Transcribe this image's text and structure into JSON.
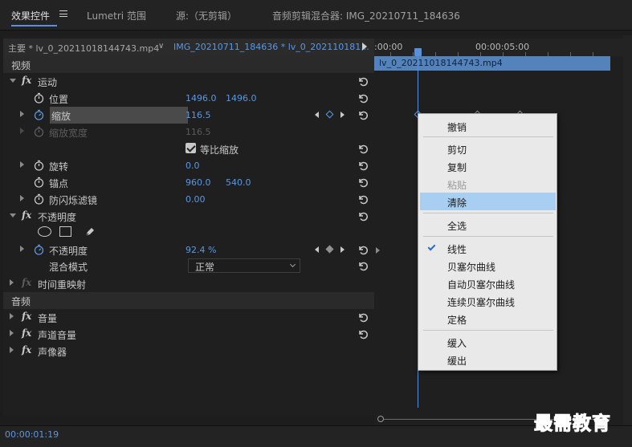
{
  "panel_tabs": {
    "effect_controls": "效果控件",
    "lumetri": "Lumetri 范围",
    "source": "源:（无剪辑）",
    "audio_mixer": "音频剪辑混合器: IMG_20210711_184636"
  },
  "source_bar": {
    "master": "主要 * lv_0_20211018144743.mp4",
    "clip": "IMG_20210711_184636 * lv_0_202110181..."
  },
  "sections": {
    "video": "视频",
    "audio": "音频"
  },
  "effects": {
    "motion": {
      "name": "运动",
      "position": {
        "label": "位置",
        "x": "1496.0",
        "y": "1496.0"
      },
      "scale": {
        "label": "缩放",
        "value": "116.5"
      },
      "scale_width": {
        "label": "缩放宽度",
        "value": "116.5"
      },
      "uniform_scale": {
        "label": "等比缩放"
      },
      "rotation": {
        "label": "旋转",
        "value": "0.0"
      },
      "anchor": {
        "label": "锚点",
        "x": "960.0",
        "y": "540.0"
      },
      "anti_flicker": {
        "label": "防闪烁滤镜",
        "value": "0.00"
      }
    },
    "opacity": {
      "name": "不透明度",
      "opacity": {
        "label": "不透明度",
        "value": "92.4 %"
      },
      "blend_mode": {
        "label": "混合模式",
        "value": "正常"
      }
    },
    "time_remap": {
      "name": "时间重映射"
    },
    "volume": {
      "name": "音量"
    },
    "channel_volume": {
      "name": "声道音量"
    },
    "panner": {
      "name": "声像器"
    }
  },
  "timeline": {
    "time_start": ":00:00",
    "time_mark": "00:00:05:00",
    "clip_name": "lv_0_20211018144743.mp4"
  },
  "footer": {
    "timecode": "00:00:01:19"
  },
  "context_menu": {
    "undo": "撤销",
    "cut": "剪切",
    "copy": "复制",
    "paste": "粘贴",
    "clear": "清除",
    "select_all": "全选",
    "linear": "线性",
    "bezier": "贝塞尔曲线",
    "auto_bezier": "自动贝塞尔曲线",
    "continuous_bezier": "连续贝塞尔曲线",
    "hold": "定格",
    "ease_in": "缓入",
    "ease_out": "缓出"
  },
  "watermark": "最需教育",
  "colors": {
    "accent": "#5b97e0",
    "clip": "#5482bb",
    "menu_selected": "#a8cff2"
  }
}
